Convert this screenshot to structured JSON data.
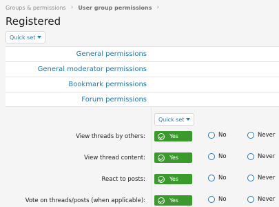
{
  "breadcrumb": {
    "items": [
      "Groups & permissions",
      "User group permissions"
    ]
  },
  "page": {
    "title": "Registered"
  },
  "toolbar": {
    "quick_set_label": "Quick set"
  },
  "sections": [
    {
      "label": "General permissions"
    },
    {
      "label": "General moderator permissions"
    },
    {
      "label": "Bookmark permissions"
    },
    {
      "label": "Forum permissions"
    }
  ],
  "forum": {
    "quick_set_label": "Quick set",
    "yes_label": "Yes",
    "no_label": "No",
    "never_label": "Never",
    "rows": [
      {
        "label": "View threads by others:",
        "value": "Yes"
      },
      {
        "label": "View thread content:",
        "value": "Yes"
      },
      {
        "label": "React to posts:",
        "value": "Yes"
      },
      {
        "label": "Vote on threads/posts (when applicable):",
        "value": "Yes"
      }
    ]
  },
  "colors": {
    "link": "#2577b1",
    "yes_green": "#3a9a2c"
  }
}
